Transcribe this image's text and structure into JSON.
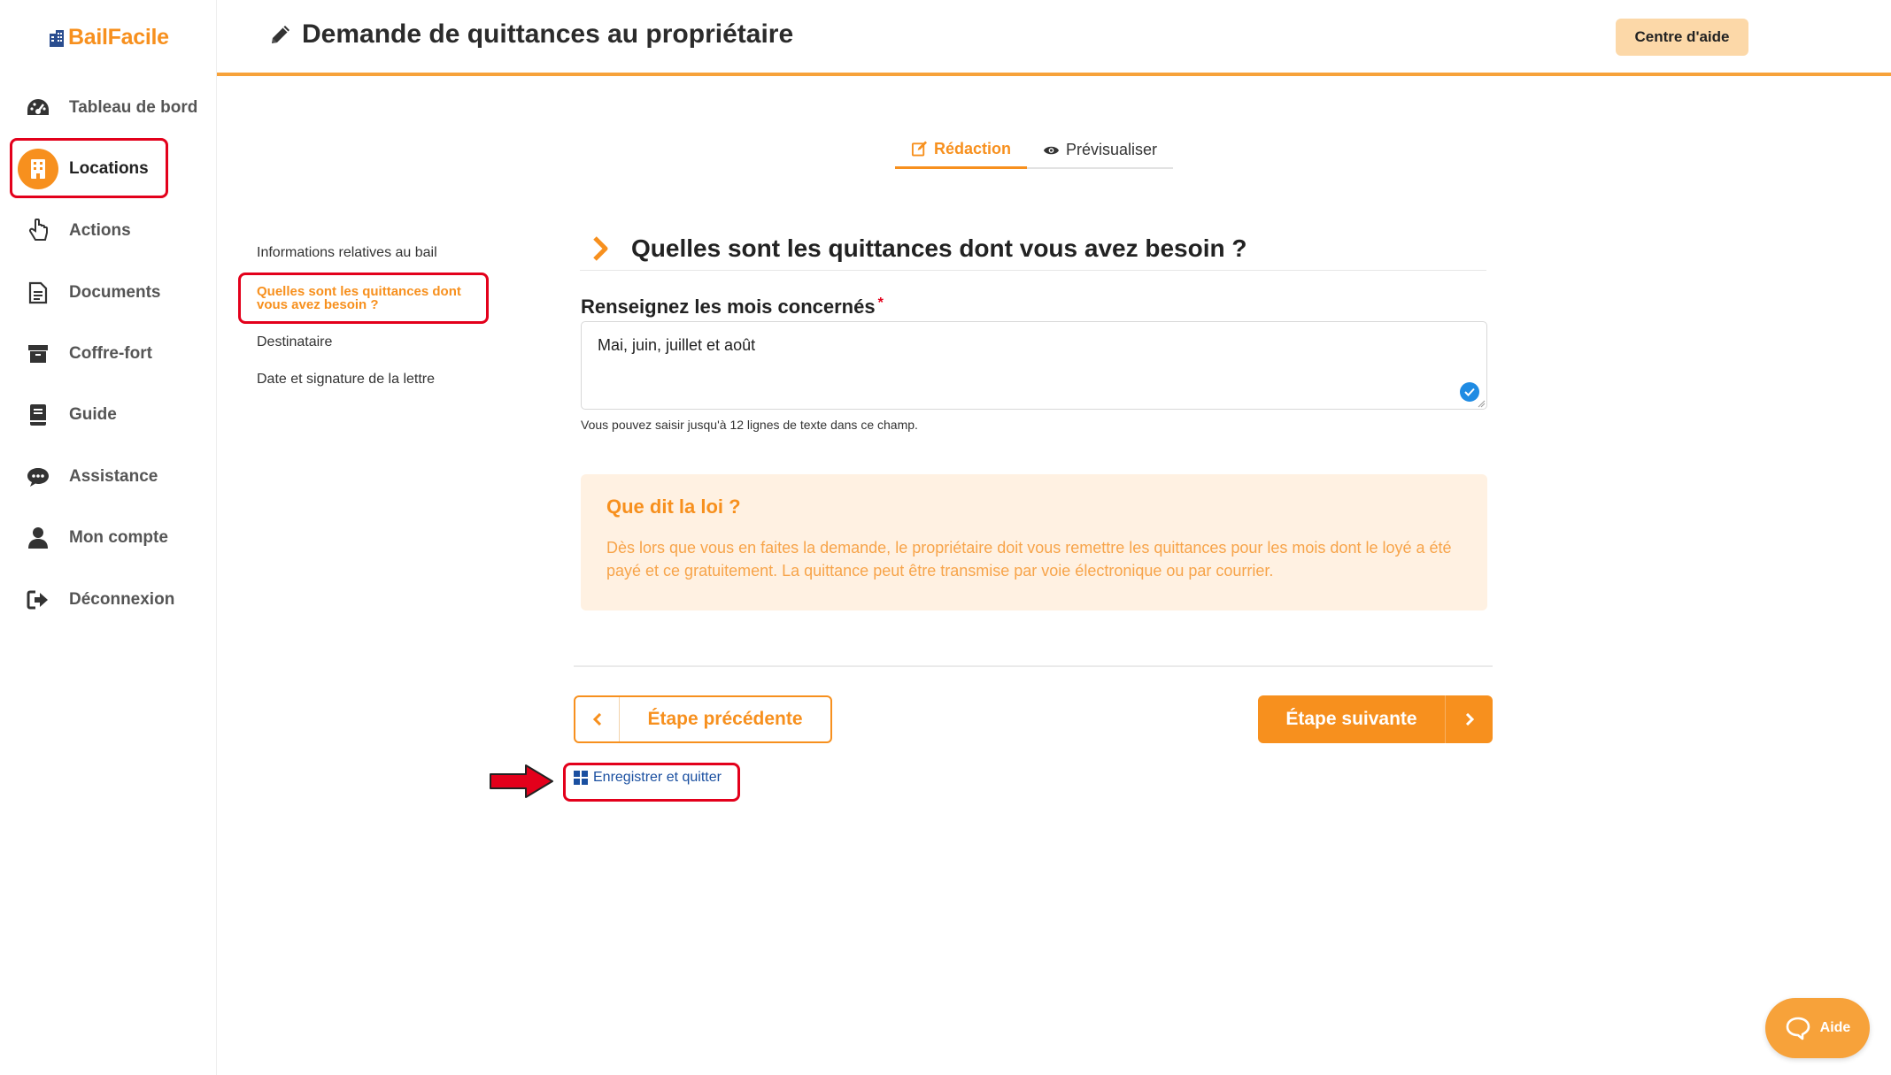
{
  "app": {
    "logo_text": "BailFacile"
  },
  "sidebar": {
    "items": [
      {
        "label": "Tableau de bord",
        "icon": "dashboard-icon"
      },
      {
        "label": "Locations",
        "icon": "building-icon",
        "active": true
      },
      {
        "label": "Actions",
        "icon": "hand-pointer-icon"
      },
      {
        "label": "Documents",
        "icon": "document-icon"
      },
      {
        "label": "Coffre-fort",
        "icon": "archive-box-icon"
      },
      {
        "label": "Guide",
        "icon": "book-icon"
      },
      {
        "label": "Assistance",
        "icon": "chat-bubble-icon"
      },
      {
        "label": "Mon compte",
        "icon": "user-icon"
      },
      {
        "label": "Déconnexion",
        "icon": "logout-icon"
      }
    ]
  },
  "header": {
    "title": "Demande de quittances au propriétaire",
    "help_button": "Centre d'aide"
  },
  "tabs": [
    {
      "label": "Rédaction",
      "icon": "edit-icon",
      "active": true
    },
    {
      "label": "Prévisualiser",
      "icon": "eye-icon",
      "active": false
    }
  ],
  "steps": [
    {
      "label": "Informations relatives au bail"
    },
    {
      "label": "Quelles sont les quittances dont vous avez besoin ?",
      "active": true
    },
    {
      "label": "Destinataire"
    },
    {
      "label": "Date et signature de la lettre"
    }
  ],
  "section": {
    "title": "Quelles sont les quittances dont vous avez besoin ?",
    "field_label": "Renseignez les mois concernés",
    "required_mark": "*",
    "field_value": "Mai, juin, juillet et août",
    "field_hint": "Vous pouvez saisir jusqu'à 12 lignes de texte dans ce champ."
  },
  "law": {
    "title": "Que dit la loi ?",
    "text": "Dès lors que vous en faites la demande, le propriétaire doit vous remettre les quittances pour les mois dont le loyé a été payé et ce gratuitement. La quittance peut être transmise par voie électronique ou par courrier."
  },
  "nav_buttons": {
    "prev": "Étape précédente",
    "next": "Étape suivante",
    "save_quit": "Enregistrer et quitter"
  },
  "chat": {
    "label": "Aide"
  },
  "colors": {
    "accent": "#f7901e",
    "highlight_box": "#e3001b",
    "link": "#1a4fa0",
    "law_bg": "#fff1e2"
  }
}
